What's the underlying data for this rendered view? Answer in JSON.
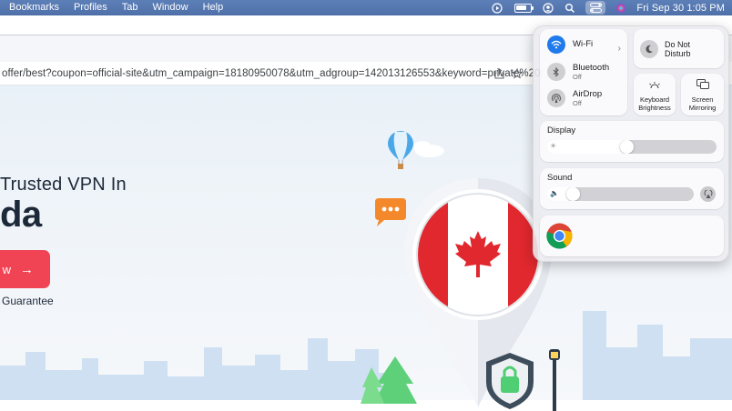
{
  "menubar": {
    "items": [
      "Bookmarks",
      "Profiles",
      "Tab",
      "Window",
      "Help"
    ],
    "clock": "Fri Sep 30  1:05 PM",
    "icons": [
      "play-icon",
      "battery-icon",
      "user-icon",
      "search-icon",
      "control-center-icon",
      "siri-icon"
    ]
  },
  "browser": {
    "url": "offer/best?coupon=official-site&utm_campaign=18180950078&utm_adgroup=142013126553&keyword=private%20i..."
  },
  "page": {
    "headline": "Trusted VPN In",
    "country": "da",
    "cta_label": "w",
    "guarantee": "Guarantee"
  },
  "control_center": {
    "wifi": {
      "label": "Wi-Fi",
      "status": ""
    },
    "bluetooth": {
      "label": "Bluetooth",
      "status": "Off"
    },
    "airdrop": {
      "label": "AirDrop",
      "status": "Off"
    },
    "dnd": {
      "line1": "Do Not",
      "line2": "Disturb"
    },
    "keyboard": {
      "line1": "Keyboard",
      "line2": "Brightness"
    },
    "mirroring": {
      "line1": "Screen",
      "line2": "Mirroring"
    },
    "display": {
      "label": "Display",
      "level": 0.47
    },
    "sound": {
      "label": "Sound",
      "level": 0.15
    },
    "now_playing": {
      "app": "Chrome"
    }
  },
  "colors": {
    "menubar": "#5576ad",
    "accent": "#1f7aeb",
    "cta": "#f04455",
    "flag_red": "#e0282e"
  }
}
